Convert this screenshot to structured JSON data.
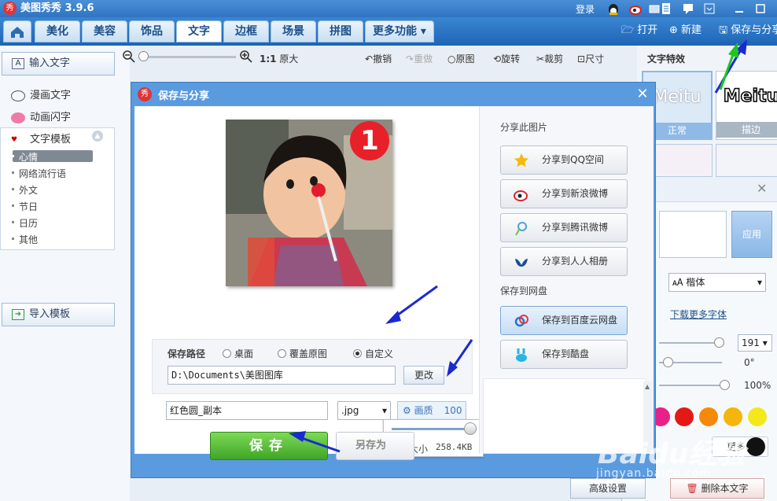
{
  "app": {
    "title": "美图秀秀 3.9.6",
    "logo_text": "秀",
    "login": "登录"
  },
  "menu": {
    "tabs": [
      "美化",
      "美容",
      "饰品",
      "文字",
      "边框",
      "场景",
      "拼图"
    ],
    "more": "更多功能",
    "active": "文字",
    "open": "打开",
    "new": "新建",
    "save_share": "保存与分享"
  },
  "left": {
    "input_text": "输入文字",
    "comic_text": "漫画文字",
    "anim_text": "动画闪字",
    "template": "文字模板",
    "template_items": [
      "心情",
      "网络流行语",
      "外文",
      "节日",
      "日历",
      "其他"
    ],
    "import_template": "导入模板"
  },
  "canvas_toolbar": {
    "original_size_prefix": "1:1",
    "original_size": "原大",
    "undo": "撤销",
    "redo": "重做",
    "original": "原图",
    "rotate": "旋转",
    "crop": "裁剪",
    "size": "尺寸"
  },
  "right": {
    "section": "文字特效",
    "styles": [
      {
        "preview": "Meitu",
        "label": "正常"
      },
      {
        "preview": "Meitu",
        "label": "描边"
      }
    ]
  },
  "edit_panel": {
    "apply": "应用",
    "font": "楷体",
    "download_fonts": "下载更多字体",
    "font_size": "191",
    "rotation": "0°",
    "opacity": "100%",
    "more": "更多",
    "colors": [
      "#e8208a",
      "#e51818",
      "#f58a0a",
      "#f5b50a",
      "#f2e81a",
      "#111111"
    ],
    "advanced": "高级设置",
    "delete_text": "删除本文字"
  },
  "dialog": {
    "title": "保存与分享",
    "badge": "1",
    "save_path_label": "保存路径",
    "path_options": [
      "桌面",
      "覆盖原图",
      "自定义"
    ],
    "selected_option": "自定义",
    "path": "D:\\Documents\\美图图库",
    "change": "更改",
    "filename": "红色圆_副本",
    "format": ".jpg",
    "quality_label": "画质",
    "quality": "100",
    "quality_level": 100,
    "size_label": "图片大小",
    "size_value": "258.4KB",
    "save": "保存",
    "save_as": "另存为",
    "share_header": "分享此图片",
    "share_buttons": [
      "分享到QQ空间",
      "分享到新浪微博",
      "分享到腾讯微博",
      "分享到人人相册"
    ],
    "cloud_header": "保存到网盘",
    "cloud_buttons": [
      "保存到百度云网盘",
      "保存到酷盘"
    ]
  },
  "watermark": {
    "brand": "Baidu经验",
    "url": "jingyan.baidu.com"
  }
}
